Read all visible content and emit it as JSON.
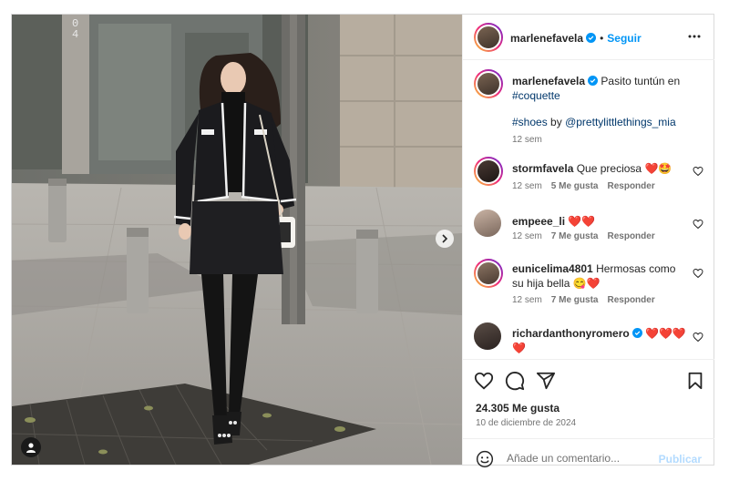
{
  "post": {
    "author": "marlenefavela",
    "follow_label": "Seguir",
    "separator": "•",
    "caption_author": "marlenefavela",
    "caption_text": "Pasito tuntún en",
    "caption_hashtag": "#coquette",
    "caption_line2_hashtag": "#shoes",
    "caption_line2_by": "by",
    "caption_line2_mention": "@prettylittlethings_mia",
    "caption_time": "12 sem",
    "likes": "24.305 Me gusta",
    "date": "10 de diciembre de 2024",
    "comment_placeholder": "Añade un comentario...",
    "publish_label": "Publicar",
    "building_number": "04"
  },
  "comments": [
    {
      "user": "stormfavela",
      "text": "Que preciosa",
      "emoji": "❤️🤩",
      "time": "12 sem",
      "likes": "5 Me gusta",
      "reply": "Responder",
      "verified": false
    },
    {
      "user": "empeee_li",
      "text": "",
      "emoji": "❤️❤️",
      "time": "12 sem",
      "likes": "7 Me gusta",
      "reply": "Responder",
      "verified": false
    },
    {
      "user": "eunicelima4801",
      "text": "Hermosas como su hija bella",
      "emoji": "😋❤️",
      "time": "12 sem",
      "likes": "7 Me gusta",
      "reply": "Responder",
      "verified": false
    },
    {
      "user": "richardanthonyromero",
      "text": "",
      "emoji": "❤️❤️❤️",
      "emoji2": "❤️",
      "verified": true
    }
  ],
  "icons": {
    "verified": "verified-badge-icon",
    "more": "more-options-icon",
    "like": "heart-icon",
    "comment": "comment-icon",
    "share": "share-icon",
    "save": "bookmark-icon",
    "emoji": "emoji-icon",
    "next": "chevron-right-icon",
    "tag": "user-tag-icon"
  },
  "colors": {
    "accent": "#0095f6",
    "link": "#00376b",
    "muted": "#737373",
    "verified": "#0095f6",
    "heart": "#ed4956"
  }
}
